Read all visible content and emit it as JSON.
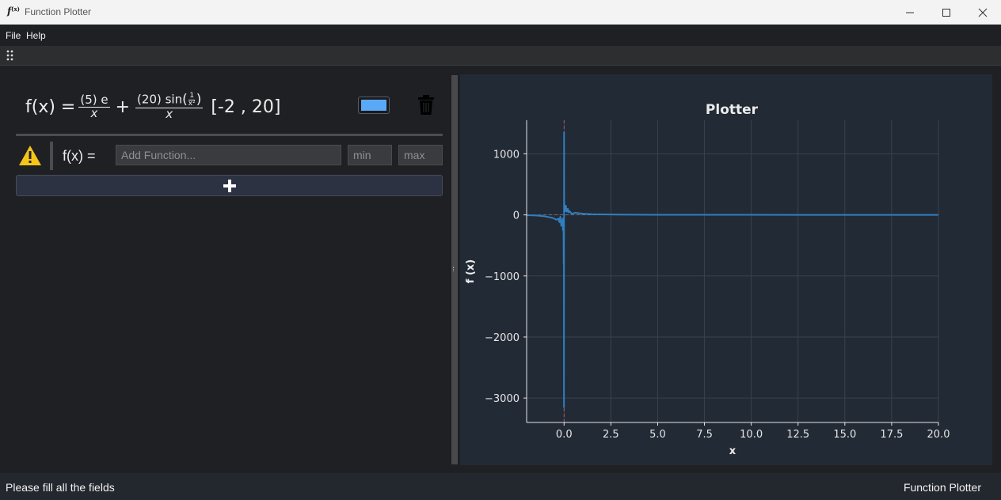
{
  "window": {
    "title": "Function Plotter",
    "icon_text": "f(x)"
  },
  "menu": {
    "items": [
      "File",
      "Help"
    ]
  },
  "functions": [
    {
      "prefix": "f(x) =",
      "term1_num": "(5) e",
      "term1_den": "x",
      "plus": "+",
      "term2_num_coef": "(20) sin",
      "term2_inner_num": "1",
      "term2_inner_den": "x²",
      "term2_den": "x",
      "range": "[-2 , 20]",
      "color": "#5aa9f7"
    }
  ],
  "input_row": {
    "label": "f(x) =",
    "function_placeholder": "Add Function...",
    "min_placeholder": "min",
    "max_placeholder": "max",
    "warning_color": "#f5c518"
  },
  "add_button_icon": "plus-icon",
  "chart_data": {
    "type": "line",
    "title": "Plotter",
    "xlabel": "x",
    "ylabel": "f (x)",
    "xlim": [
      -2,
      20
    ],
    "ylim": [
      -3400,
      1550
    ],
    "xticks": [
      0.0,
      2.5,
      5.0,
      7.5,
      10.0,
      12.5,
      15.0,
      17.5,
      20.0
    ],
    "xtick_labels": [
      "0.0",
      "2.5",
      "5.0",
      "7.5",
      "10.0",
      "12.5",
      "15.0",
      "17.5",
      "20.0"
    ],
    "yticks": [
      1000,
      0,
      -1000,
      -2000,
      -3000
    ],
    "ytick_labels": [
      "1000",
      "0",
      "−1000",
      "−2000",
      "−3000"
    ],
    "grid": true,
    "series": [
      {
        "color": "#2f7fc1",
        "x": [
          -2.0,
          -1.5,
          -1.0,
          -0.6,
          -0.4,
          -0.3,
          -0.25,
          -0.2,
          -0.15,
          -0.12,
          -0.1,
          -0.08,
          -0.06,
          -0.04,
          -0.03,
          -0.02,
          -0.01,
          -0.005,
          0.0,
          0.005,
          0.01,
          0.02,
          0.03,
          0.04,
          0.06,
          0.08,
          0.1,
          0.12,
          0.15,
          0.2,
          0.25,
          0.3,
          0.4,
          0.6,
          1.0,
          1.5,
          2.0,
          3.0,
          5.0,
          10.0,
          15.0,
          20.0
        ],
        "y": [
          -5,
          -10,
          -25,
          -50,
          -80,
          -60,
          -120,
          -30,
          -180,
          -100,
          -140,
          -60,
          -250,
          -200,
          -120,
          -800,
          -380,
          -3150,
          1350,
          300,
          150,
          60,
          140,
          100,
          60,
          120,
          150,
          80,
          50,
          100,
          40,
          60,
          20,
          35,
          20,
          12,
          8,
          4,
          2,
          1,
          0.5,
          0.3
        ]
      }
    ],
    "reference_lines": {
      "y0_color": "#7f7f7f",
      "x0_color": "#c0666a"
    }
  },
  "status": {
    "left": "Please fill all the fields",
    "right": "Function Plotter"
  }
}
